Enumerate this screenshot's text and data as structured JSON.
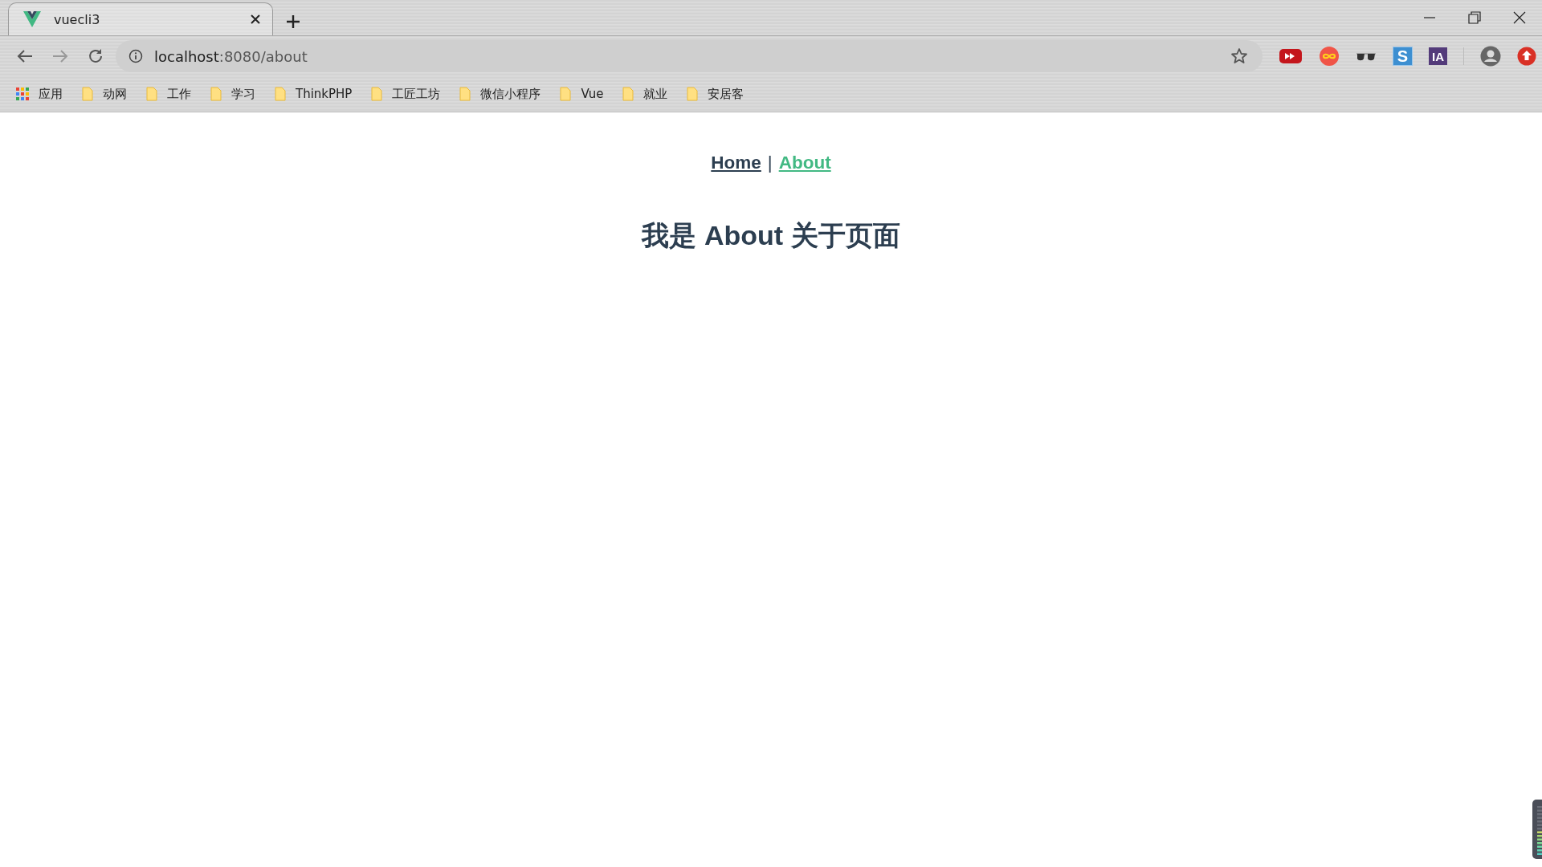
{
  "tabs": [
    {
      "title": "vuecli3",
      "selected": true
    }
  ],
  "address_bar": {
    "host": "localhost",
    "path": ":8080/about"
  },
  "extensions": [
    {
      "kind": "play"
    },
    {
      "kind": "infinity"
    },
    {
      "kind": "glasses"
    },
    {
      "kind": "letter",
      "label": "S"
    },
    {
      "kind": "badge",
      "label": "IA"
    }
  ],
  "bookmarks": [
    {
      "kind": "apps",
      "label": "应用"
    },
    {
      "kind": "folder",
      "label": "动网"
    },
    {
      "kind": "folder",
      "label": "工作"
    },
    {
      "kind": "folder",
      "label": "学习"
    },
    {
      "kind": "folder",
      "label": "ThinkPHP"
    },
    {
      "kind": "folder",
      "label": "工匠工坊"
    },
    {
      "kind": "folder",
      "label": "微信小程序"
    },
    {
      "kind": "folder",
      "label": "Vue"
    },
    {
      "kind": "folder",
      "label": "就业"
    },
    {
      "kind": "folder",
      "label": "安居客"
    }
  ],
  "nav": {
    "links": [
      {
        "label": "Home",
        "selected": false
      },
      {
        "label": "About",
        "selected": true
      }
    ],
    "separator": "|"
  },
  "heading": "我是 About 关于页面"
}
